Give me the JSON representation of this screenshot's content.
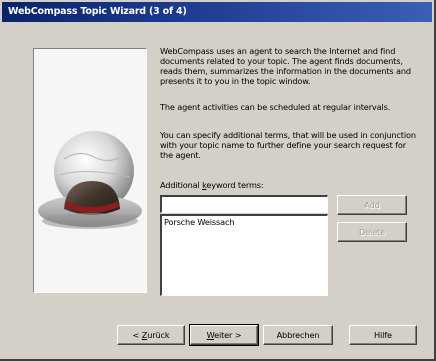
{
  "window": {
    "title": "WebCompass Topic Wizard (3 of 4)"
  },
  "description": {
    "para1": "WebCompass uses an agent to search the Internet and find documents related to your topic. The agent finds documents, reads them, summarizes the information in the documents and presents it to you in the topic window.",
    "para2": "The agent activities can be scheduled at regular intervals.",
    "para3": "You can specify additional terms, that will be used in conjunction with your topic name to further define your search request for the agent."
  },
  "keywords": {
    "label_prefix": "Additional ",
    "label_accel": "k",
    "label_suffix": "eyword terms:",
    "input_value": "",
    "items": [
      "Porsche Weissach"
    ]
  },
  "buttons": {
    "add": "Add",
    "delete": "Delete",
    "back_prefix": "< ",
    "back_accel": "Z",
    "back_suffix": "urück",
    "next_accel": "W",
    "next_suffix": "eiter >",
    "cancel": "Abbrechen",
    "help": "Hilfe"
  },
  "illustration": {
    "icon": "globe-with-hat-icon"
  }
}
